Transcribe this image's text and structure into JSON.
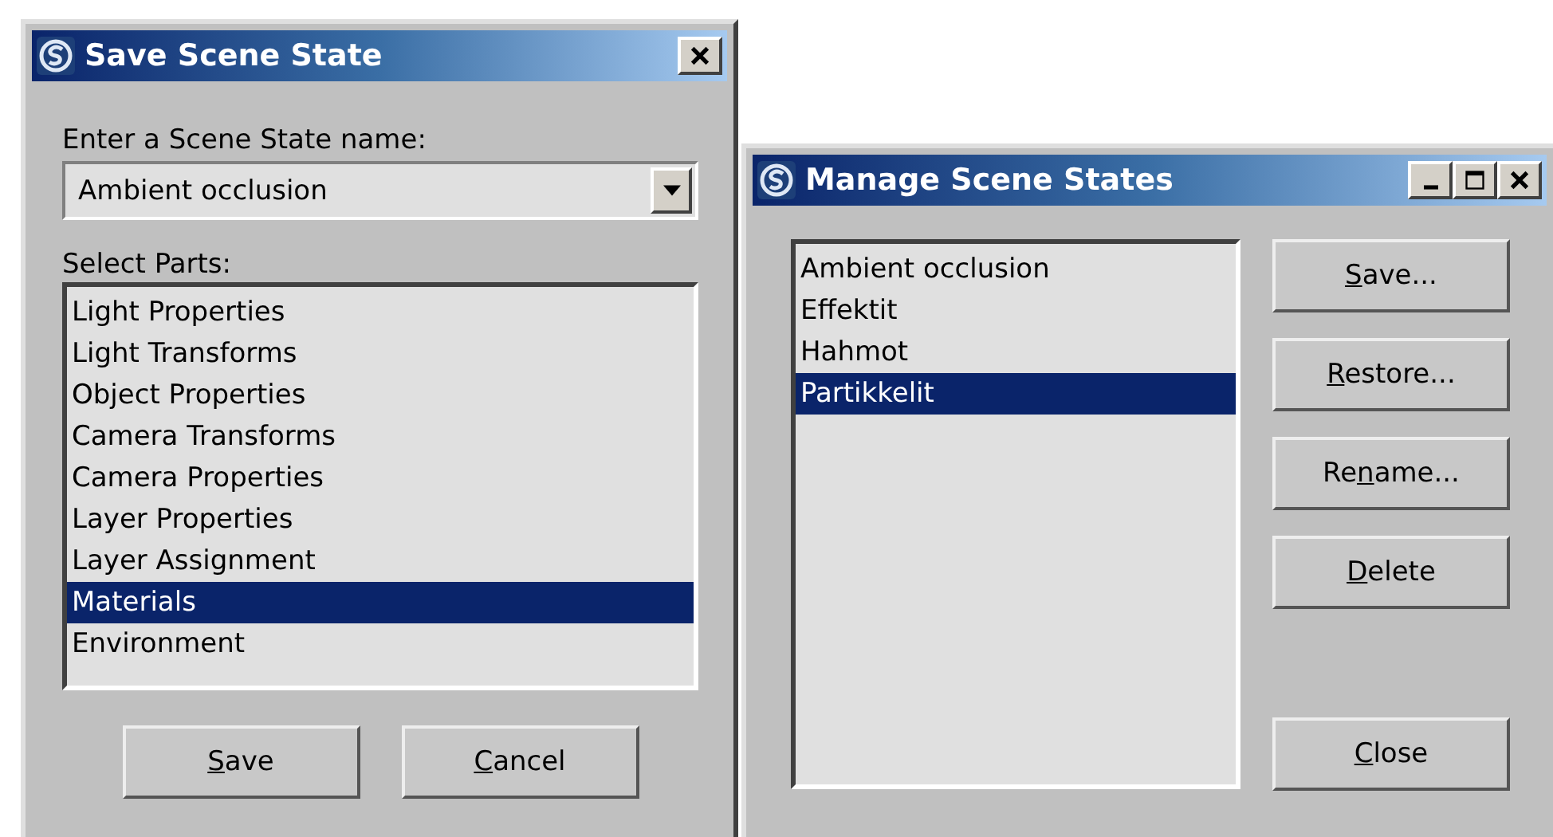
{
  "windows": [
    {
      "title": "Save Scene State",
      "controls": [
        {
          "kind": "close"
        }
      ],
      "kind": "save",
      "name_label": "Enter a Scene State name:",
      "name_value": "Ambient occlusion",
      "list_label": "Select Parts:",
      "items": [
        {
          "text": "Light Properties",
          "selected": false
        },
        {
          "text": "Light Transforms",
          "selected": false
        },
        {
          "text": "Object Properties",
          "selected": false
        },
        {
          "text": "Camera Transforms",
          "selected": false
        },
        {
          "text": "Camera Properties",
          "selected": false
        },
        {
          "text": "Layer Properties",
          "selected": false
        },
        {
          "text": "Layer Assignment",
          "selected": false
        },
        {
          "text": "Materials",
          "selected": true
        },
        {
          "text": "Environment",
          "selected": false
        }
      ],
      "buttons": [
        {
          "key": "S",
          "after": "ave"
        },
        {
          "key": "C",
          "after": "ancel"
        }
      ]
    },
    {
      "title": "Manage Scene States",
      "controls": [
        {
          "kind": "minimize"
        },
        {
          "kind": "maximize"
        },
        {
          "kind": "close"
        }
      ],
      "kind": "manage",
      "items": [
        {
          "text": "Ambient occlusion",
          "selected": false
        },
        {
          "text": "Effektit",
          "selected": false
        },
        {
          "text": "Hahmot",
          "selected": false
        },
        {
          "text": "Partikkelit",
          "selected": true
        }
      ],
      "buttons": [
        {
          "key": "S",
          "after": "ave..."
        },
        {
          "key": "R",
          "after": "estore..."
        },
        {
          "before": "Re",
          "key": "n",
          "after": "ame..."
        },
        {
          "key": "D",
          "after": "elete"
        },
        {
          "key": "C",
          "after": "lose"
        }
      ]
    }
  ]
}
